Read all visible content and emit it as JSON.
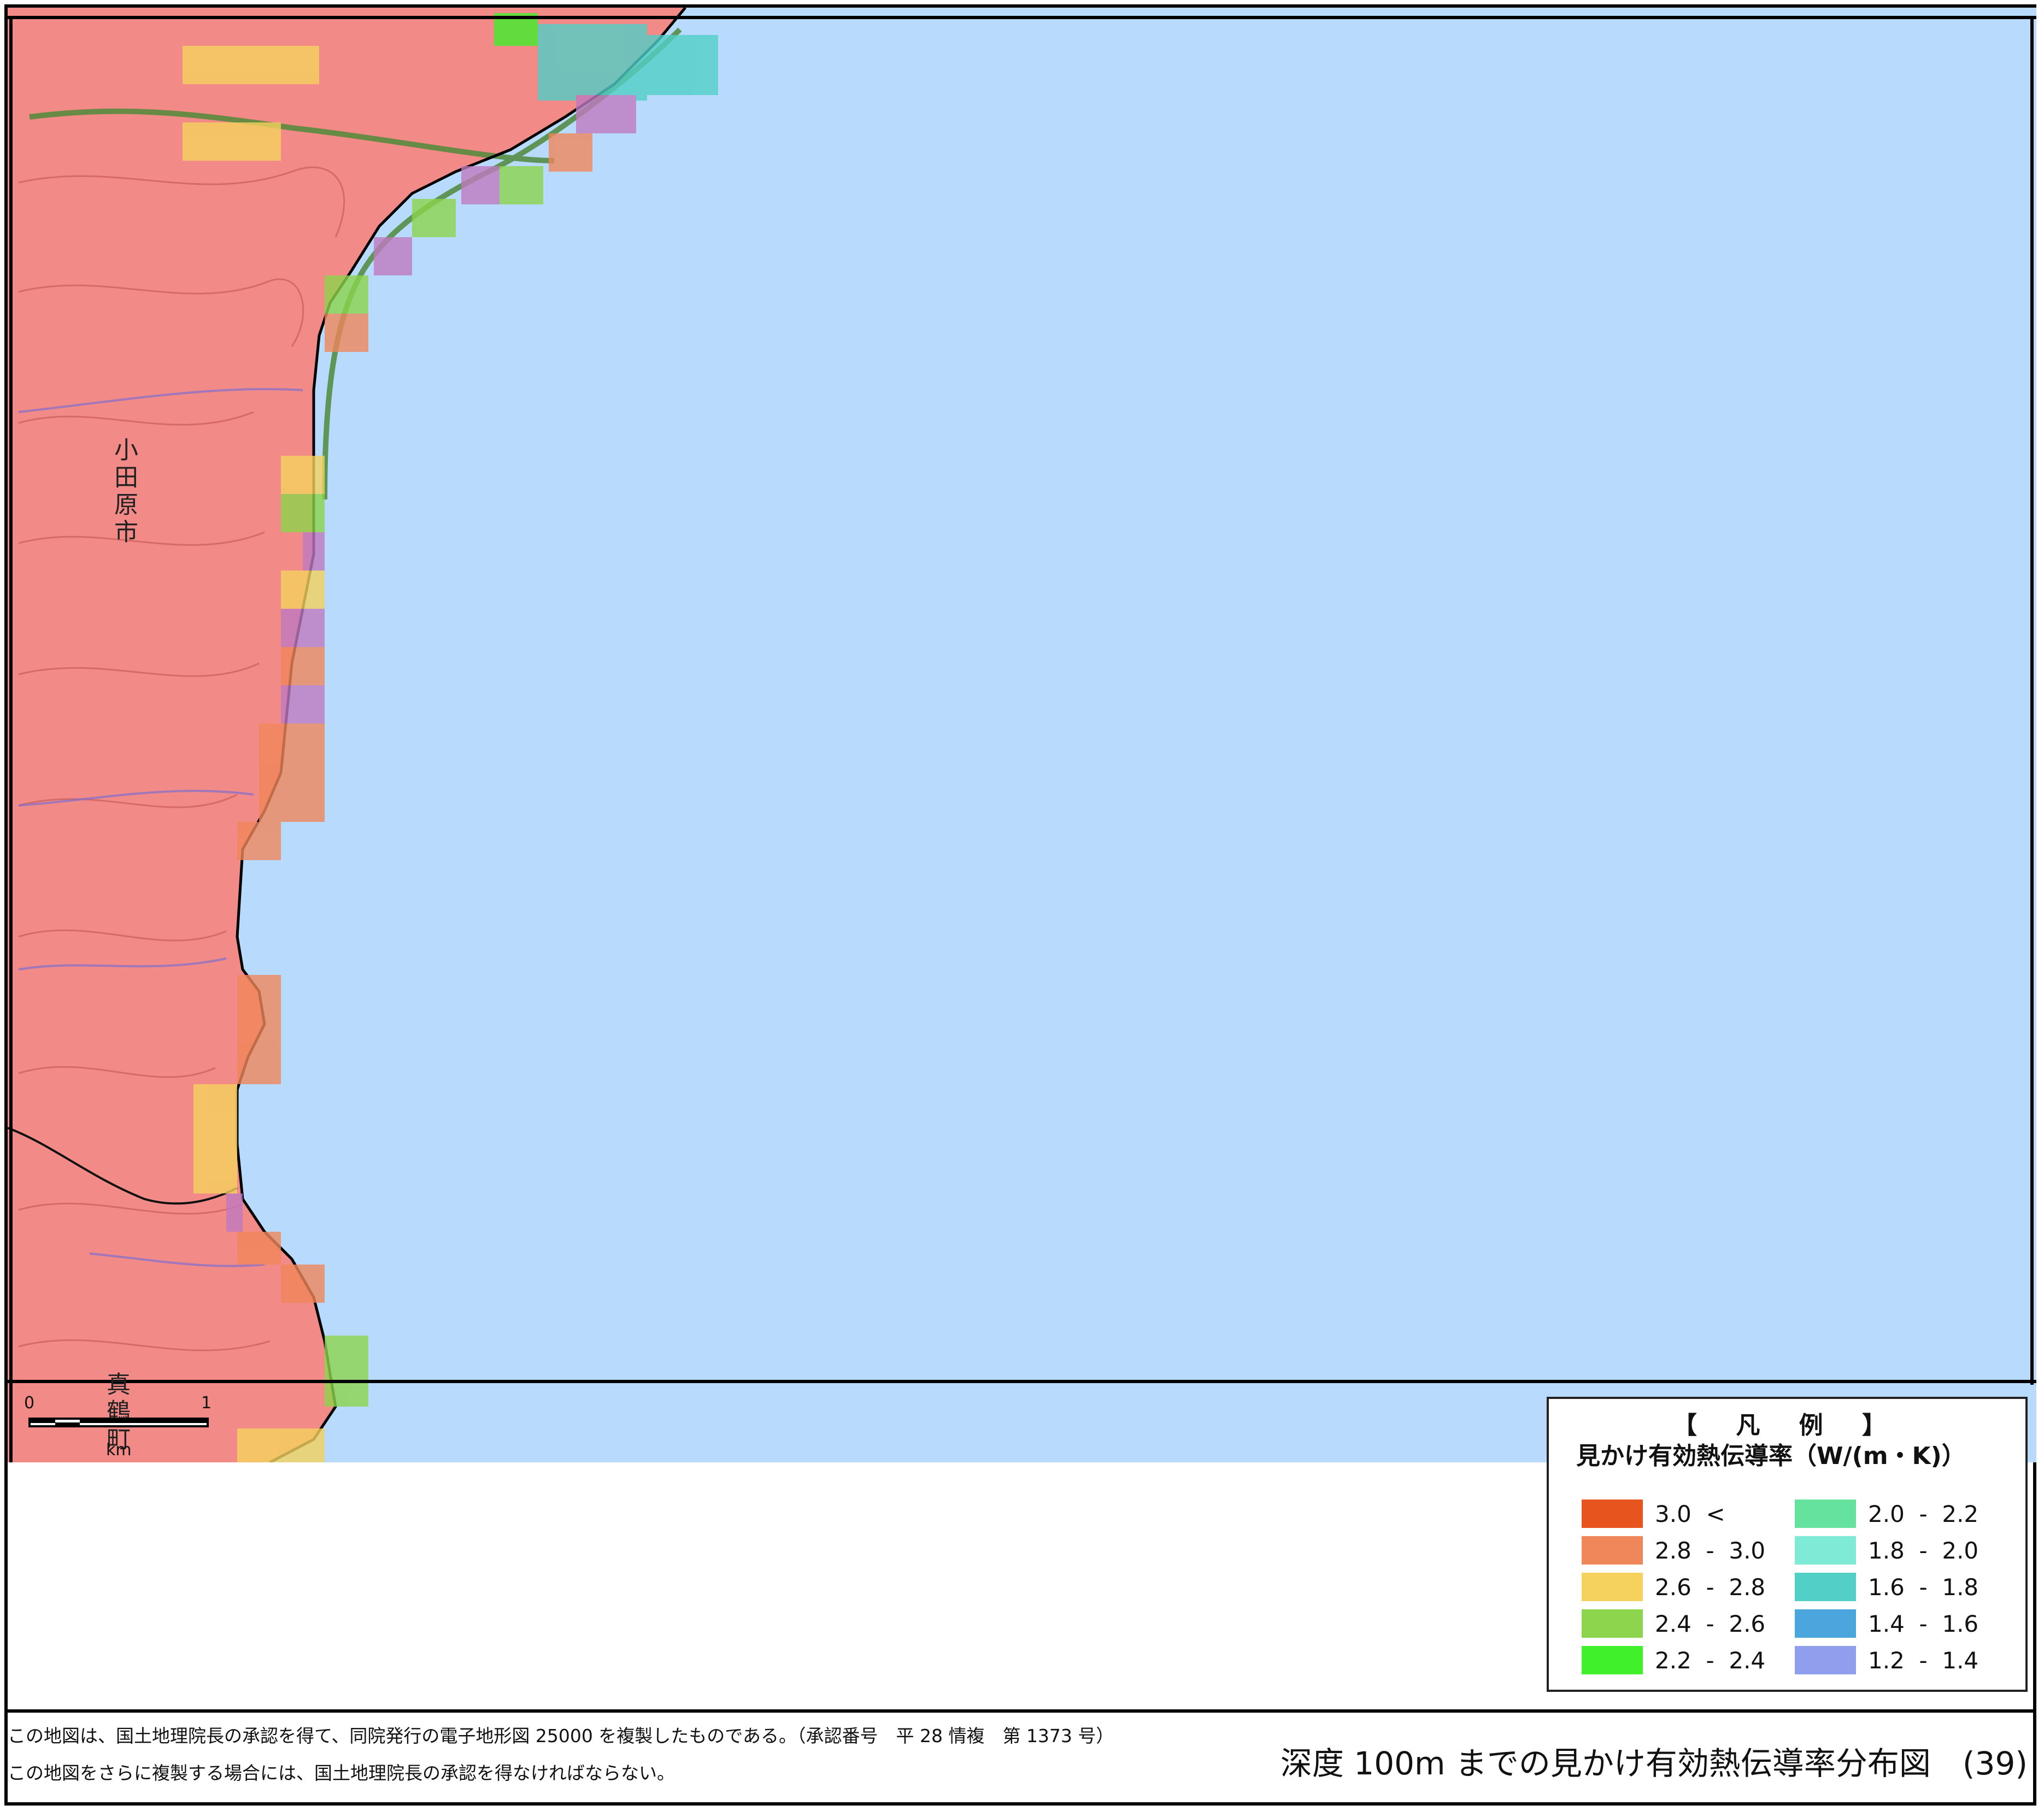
{
  "map": {
    "places": {
      "odawara_city": "小田原市",
      "manazuru_town": "真鶴町"
    },
    "scale_bar": {
      "start": "0",
      "end": "1",
      "unit": "km"
    },
    "colors": {
      "sea": "#b7dafd",
      "land": "#f28a87",
      "contour": "#c0504d",
      "road": "#4f8a3a",
      "river": "#7f6fd0",
      "coastline": "#000000"
    }
  },
  "legend": {
    "title": "【 凡 例 】",
    "subtitle": "見かけ有効熱伝導率（W/(m・K)）",
    "items": [
      {
        "label": "3.0  <",
        "color": "#e8541e"
      },
      {
        "label": "2.8  -  3.0",
        "color": "#f0875a"
      },
      {
        "label": "2.6  -  2.8",
        "color": "#f5d25e"
      },
      {
        "label": "2.4  -  2.6",
        "color": "#8dd54c"
      },
      {
        "label": "2.2  -  2.4",
        "color": "#3ff02a"
      },
      {
        "label": "2.0  -  2.2",
        "color": "#66e29f"
      },
      {
        "label": "1.8  -  2.0",
        "color": "#7fead6"
      },
      {
        "label": "1.6  -  1.8",
        "color": "#52cfc7"
      },
      {
        "label": "1.4  -  1.6",
        "color": "#4aa6dd"
      },
      {
        "label": "1.2  -  1.4",
        "color": "#8f9fed"
      }
    ]
  },
  "footer": {
    "note_line1": "この地図は、国土地理院長の承認を得て、同院発行の電子地形図 25000 を複製したものである。（承認番号　平 28 情複　第 1373 号）",
    "note_line2": "この地図をさらに複製する場合には、国土地理院長の承認を得なければならない。",
    "title": "深度 100m までの見かけ有効熱伝導率分布図　(39)"
  }
}
